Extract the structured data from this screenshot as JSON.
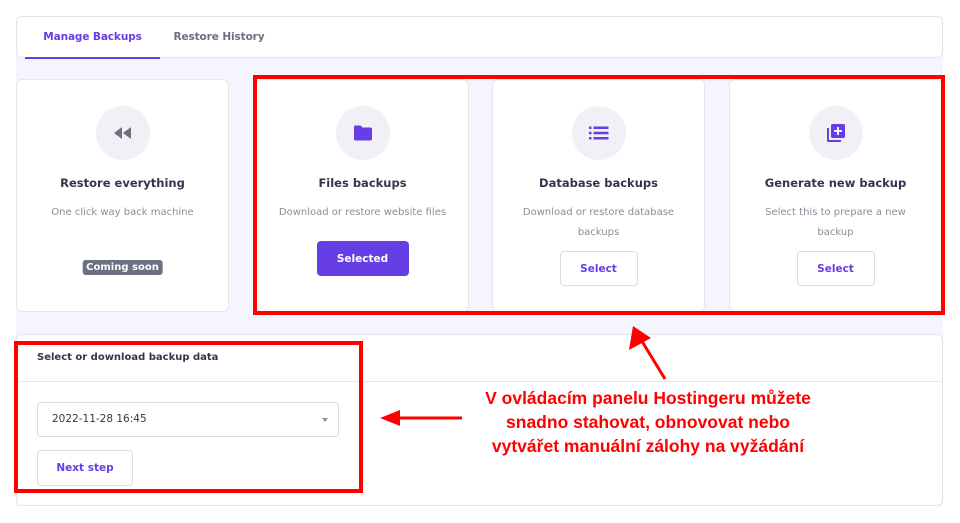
{
  "tabs": [
    {
      "label": "Manage Backups",
      "active": true
    },
    {
      "label": "Restore History",
      "active": false
    }
  ],
  "cards": [
    {
      "icon": "rewind-icon",
      "title": "Restore everything",
      "description": "One click way back machine",
      "action": {
        "type": "badge",
        "label": "Coming soon"
      }
    },
    {
      "icon": "folder-icon",
      "title": "Files backups",
      "description": "Download or restore website files",
      "action": {
        "type": "selected",
        "label": "Selected"
      }
    },
    {
      "icon": "list-icon",
      "title": "Database backups",
      "description": "Download or restore database backups",
      "action": {
        "type": "button",
        "label": "Select"
      }
    },
    {
      "icon": "library-add-icon",
      "title": "Generate new backup",
      "description": "Select this to prepare a new backup",
      "action": {
        "type": "button",
        "label": "Select"
      }
    }
  ],
  "backup_panel": {
    "header": "Select or download backup data",
    "selected_date": "2022-11-28 16:45",
    "next_label": "Next step"
  },
  "annotation": {
    "lines": [
      "V ovládacím panelu Hostingeru můžete",
      "snadno stahovat, obnovovat nebo",
      "vytvářet manuální zálohy na vyžádání"
    ]
  },
  "colors": {
    "accent": "#673de6",
    "annotation_red": "#ff0000",
    "badge_gray": "#6d7081",
    "background": "#f4f5ff"
  }
}
